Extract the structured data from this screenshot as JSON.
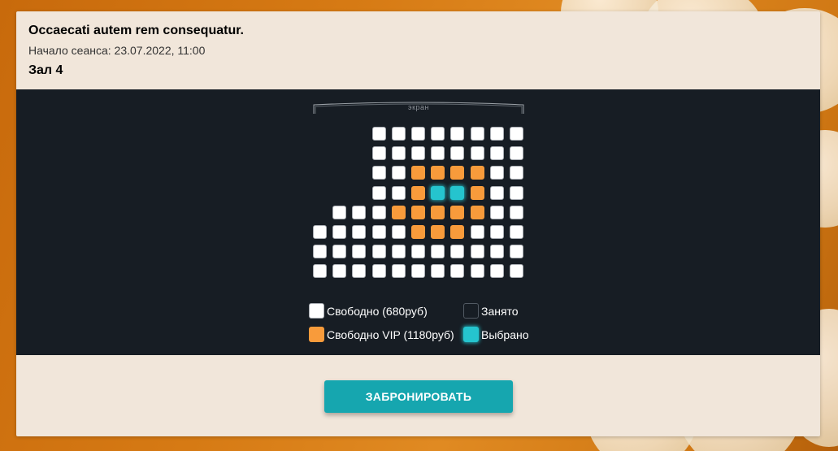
{
  "session": {
    "film_title": "Occaecati autem rem consequatur.",
    "start_label": "Начало сеанса: 23.07.2022, 11:00",
    "hall_name": "Зал 4"
  },
  "screen_label": "экран",
  "seat_rows": [
    [
      "none",
      "none",
      "none",
      "free",
      "free",
      "free",
      "free",
      "free",
      "free",
      "free",
      "free"
    ],
    [
      "none",
      "none",
      "none",
      "free",
      "free",
      "free",
      "free",
      "free",
      "free",
      "free",
      "free"
    ],
    [
      "none",
      "none",
      "none",
      "free",
      "free",
      "vip",
      "vip",
      "vip",
      "vip",
      "free",
      "free"
    ],
    [
      "none",
      "none",
      "none",
      "free",
      "free",
      "vip",
      "selected",
      "selected",
      "vip",
      "free",
      "free"
    ],
    [
      "none",
      "free",
      "free",
      "free",
      "vip",
      "vip",
      "vip",
      "vip",
      "vip",
      "free",
      "free"
    ],
    [
      "free",
      "free",
      "free",
      "free",
      "free",
      "vip",
      "vip",
      "vip",
      "free",
      "free",
      "free"
    ],
    [
      "free",
      "free",
      "free",
      "free",
      "free",
      "free",
      "free",
      "free",
      "free",
      "free",
      "free"
    ],
    [
      "free",
      "free",
      "free",
      "free",
      "free",
      "free",
      "free",
      "free",
      "free",
      "free",
      "free"
    ]
  ],
  "legend": {
    "free_label": "Свободно (680руб)",
    "taken_label": "Занято",
    "vip_label": "Свободно VIP (1180руб)",
    "selected_label": "Выбрано"
  },
  "colors": {
    "free": "#ffffff",
    "vip": "#f89b3b",
    "selected": "#25c4ce",
    "hall_background": "#171d24",
    "button": "#16a6af"
  },
  "book_button_label": "ЗАБРОНИРОВАТЬ"
}
